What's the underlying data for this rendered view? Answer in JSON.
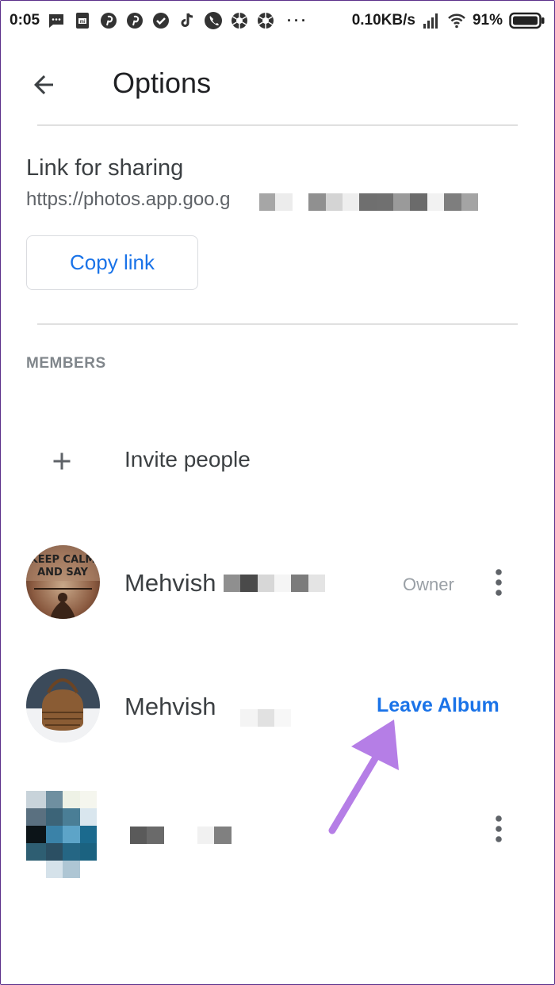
{
  "status_bar": {
    "time": "0:05",
    "network_speed": "0.10KB/s",
    "battery_percent": "91%",
    "notification_icons": [
      "message-icon",
      "mi-icon",
      "pinterest-icon",
      "pinterest-icon",
      "check-circle-icon",
      "tiktok-icon",
      "phone-icon",
      "aperture-icon",
      "aperture-icon"
    ],
    "overflow": "···"
  },
  "header": {
    "title": "Options",
    "back_icon": "arrow-back-icon"
  },
  "sharing": {
    "label": "Link for sharing",
    "url_visible": "https://photos.app.goo.g",
    "copy_button_label": "Copy link"
  },
  "members": {
    "section_label": "MEMBERS",
    "invite_label": "Invite people",
    "invite_icon": "plus-icon",
    "list": [
      {
        "name": "Mehvish",
        "role": "Owner",
        "action": "more-vert-icon",
        "avatar_caption_lines": [
          "KEEP CALM",
          "AND SAY"
        ]
      },
      {
        "name": "Mehvish",
        "action_label": "Leave Album"
      },
      {
        "name": "",
        "action": "more-vert-icon"
      }
    ]
  },
  "colors": {
    "accent": "#1a73e8",
    "annotation_arrow": "#b57ee6",
    "text_primary": "#3c4043",
    "text_secondary": "#80868b",
    "divider": "#e0e0e0"
  }
}
